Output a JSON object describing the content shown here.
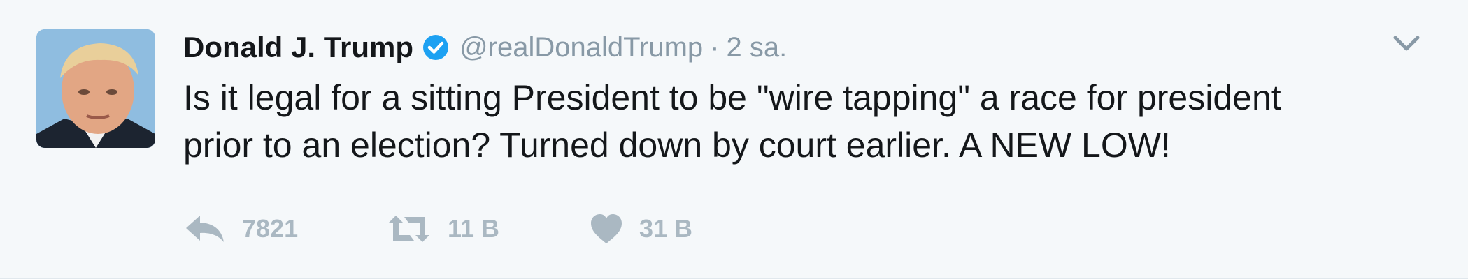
{
  "tweet": {
    "display_name": "Donald J. Trump",
    "handle": "@realDonaldTrump",
    "separator": "·",
    "time": "2 sa.",
    "text_line1": "Is it legal for a sitting President to be \"wire tapping\" a race for president",
    "text_line2": "prior to an election? Turned down by court earlier. A NEW LOW!",
    "verified": true
  },
  "actions": {
    "reply_count": "7821",
    "retweet_count": "11 B",
    "like_count": "31 B"
  },
  "icons": {
    "reply": "reply-icon",
    "retweet": "retweet-icon",
    "like": "heart-icon",
    "menu": "chevron-down-icon",
    "verified": "verified-badge-icon"
  },
  "colors": {
    "background": "#f5f8fa",
    "text": "#14171a",
    "muted": "#8899a6",
    "action_icon": "#aab8c2",
    "verified_blue": "#1da1f2"
  }
}
